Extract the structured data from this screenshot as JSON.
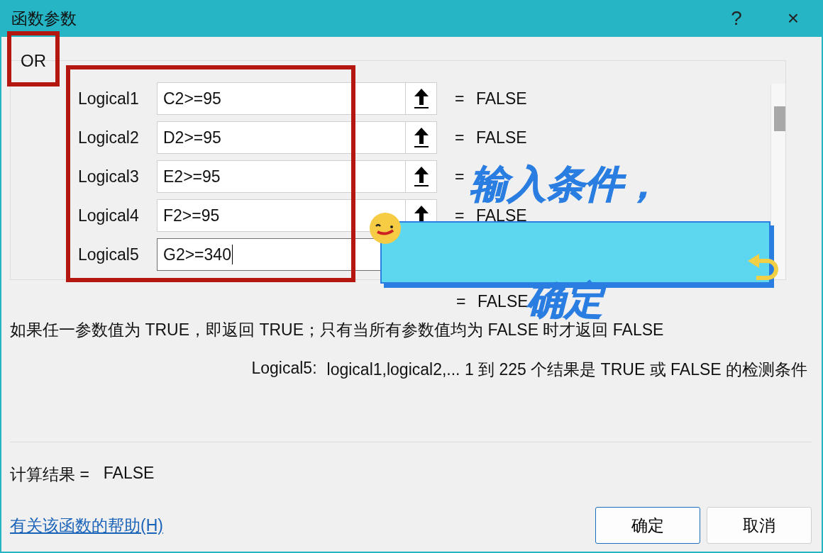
{
  "window": {
    "title": "函数参数",
    "help_button": "?",
    "close_button": "×"
  },
  "function_name": "OR",
  "arguments": [
    {
      "label": "Logical1",
      "value": "C2>=95",
      "result": "FALSE",
      "focused": false
    },
    {
      "label": "Logical2",
      "value": "D2>=95",
      "result": "FALSE",
      "focused": false
    },
    {
      "label": "Logical3",
      "value": "E2>=95",
      "focused": false
    },
    {
      "label": "Logical4",
      "value": "F2>=95",
      "result": "FALSE",
      "focused": false
    },
    {
      "label": "Logical5",
      "value": "G2>=340",
      "focused": true
    }
  ],
  "extra_results": [
    "FALSE"
  ],
  "equals_sign": "=",
  "description": "如果任一参数值为 TRUE，即返回 TRUE；只有当所有参数值均为 FALSE 时才返回 FALSE",
  "argument_help": {
    "name": "Logical5:",
    "text": "logical1,logical2,... 1 到 225 个结果是 TRUE 或 FALSE 的检测条件"
  },
  "formula_result": {
    "label": "计算结果 =",
    "value": "FALSE"
  },
  "help_link": "有关该函数的帮助(H)",
  "buttons": [
    {
      "label": "确定",
      "default": true
    },
    {
      "label": "取消",
      "default": false
    }
  ],
  "annotation": {
    "lines": [
      "输入条件，",
      "确定"
    ]
  }
}
